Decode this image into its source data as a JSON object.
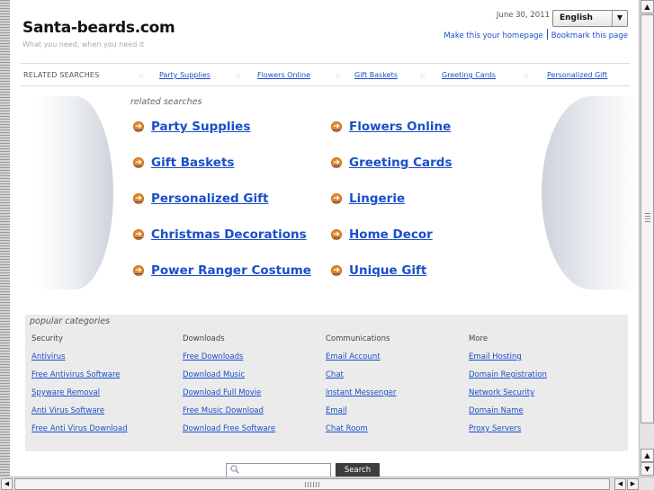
{
  "header": {
    "site_title": "Santa-beards.com",
    "tagline": "What you need, when you need it",
    "date": "June 30, 2011",
    "language": "English",
    "make_homepage": "Make this your homepage",
    "bookmark": "Bookmark this page"
  },
  "related_bar": {
    "label": "RELATED SEARCHES",
    "separator": "::",
    "items": [
      "Party Supplies",
      "Flowers Online",
      "Gift Baskets",
      "Greeting Cards",
      "Personalized Gift"
    ]
  },
  "related_searches": {
    "heading": "related searches",
    "arrow_icon": "arrow-right-circle-icon",
    "left": [
      "Party Supplies",
      "Gift Baskets",
      "Personalized Gift",
      "Christmas Decorations",
      "Power Ranger Costume"
    ],
    "right": [
      "Flowers Online",
      "Greeting Cards",
      "Lingerie",
      "Home Decor",
      "Unique Gift"
    ]
  },
  "popular": {
    "title": "popular categories",
    "columns": [
      {
        "heading": "Security",
        "links": [
          "Antivirus",
          "Free Antivirus Software",
          "Spyware Removal",
          "Anti Virus Software",
          "Free Anti Virus Download"
        ]
      },
      {
        "heading": "Downloads",
        "links": [
          "Free Downloads",
          "Download Music",
          "Download Full Movie",
          "Free Music Download",
          "Download Free Software"
        ]
      },
      {
        "heading": "Communications",
        "links": [
          "Email Account",
          "Chat",
          "Instant Messenger",
          "Email",
          "Chat Room"
        ]
      },
      {
        "heading": "More",
        "links": [
          "Email Hosting",
          "Domain Registration",
          "Network Security",
          "Domain Name",
          "Proxy Servers"
        ]
      }
    ]
  },
  "search": {
    "value": "",
    "button_label": "Search"
  },
  "colors": {
    "link": "#1a4fc9",
    "arrow": "#e8892a",
    "panel_bg": "#ebebeb",
    "search_button": "#3d3d3d"
  }
}
